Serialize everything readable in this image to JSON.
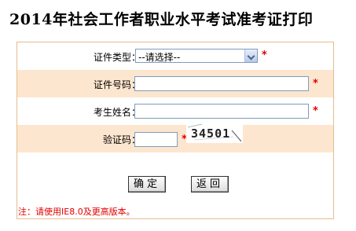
{
  "page_title": "2014年社会工作者职业水平考试准考证打印",
  "form": {
    "cert_type": {
      "label": "证件类型：",
      "selected": "--请选择--",
      "required_mark": "*"
    },
    "cert_number": {
      "label": "证件号码：",
      "value": "",
      "required_mark": "*"
    },
    "name": {
      "label": "考生姓名：",
      "value": "",
      "required_mark": "*"
    },
    "captcha": {
      "label": "验证码：",
      "value": "",
      "required_mark": "*",
      "image_text": "34501"
    },
    "confirm_label": "确定",
    "back_label": "返回",
    "note": "注：请使用IE8.0及更高版本。"
  },
  "colors": {
    "border": "#e6bc8f",
    "alt_row": "#fde6cf",
    "required": "#e00000"
  },
  "icons": {
    "dropdown": "chevron-down-icon"
  }
}
